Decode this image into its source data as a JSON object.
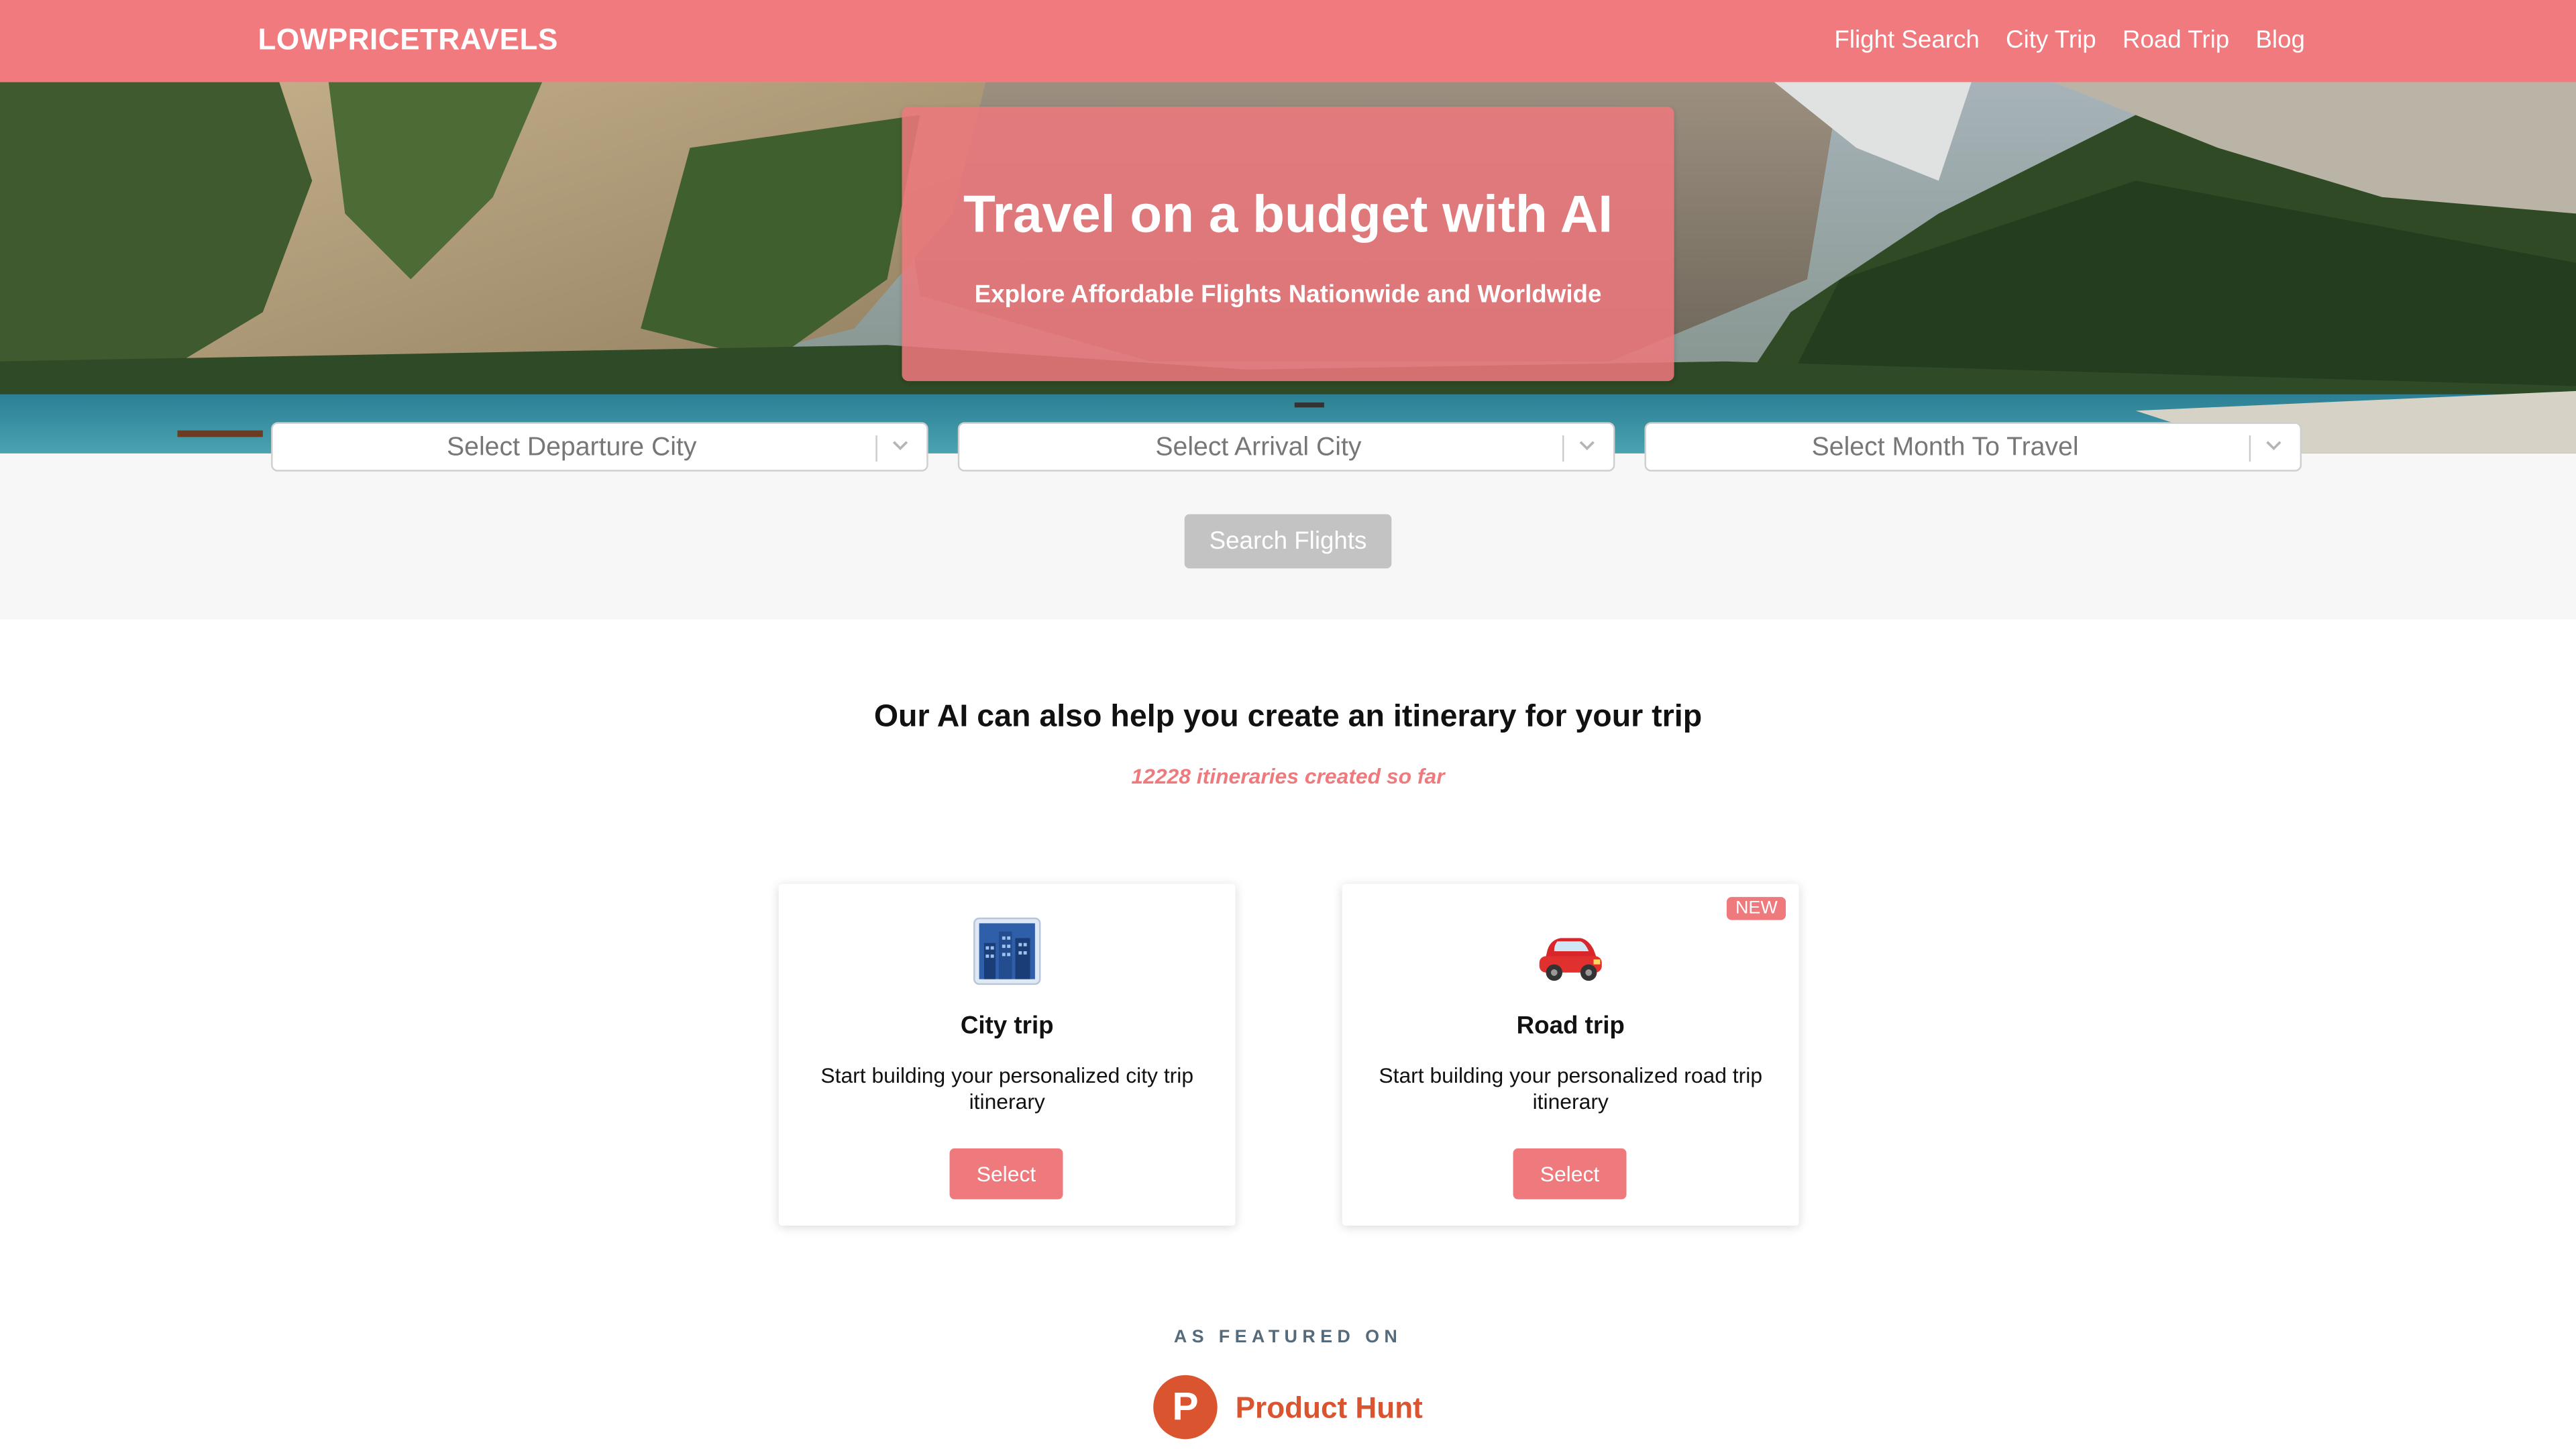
{
  "navbar": {
    "brand": "LOWPRICETRAVELS",
    "links": [
      "Flight Search",
      "City Trip",
      "Road Trip",
      "Blog"
    ]
  },
  "hero": {
    "title": "Travel on a budget with AI",
    "subtitle": "Explore Affordable Flights Nationwide and Worldwide"
  },
  "search": {
    "departure_placeholder": "Select Departure City",
    "arrival_placeholder": "Select Arrival City",
    "month_placeholder": "Select Month To Travel",
    "button_label": "Search Flights"
  },
  "itinerary": {
    "title": "Our AI can also help you create an itinerary for your trip",
    "counter": "12228 itineraries created so far",
    "cards": [
      {
        "icon": "cityscape-icon",
        "title": "City trip",
        "description": "Start building your personalized city trip itinerary",
        "button_label": "Select"
      },
      {
        "icon": "car-icon",
        "badge": "NEW",
        "title": "Road trip",
        "description": "Start building your personalized road trip itinerary",
        "button_label": "Select"
      }
    ]
  },
  "featured": {
    "label": "AS FEATURED ON",
    "logo_letter": "P",
    "logo_text": "Product Hunt"
  },
  "colors": {
    "accent": "#f07a7e",
    "search_button_disabled": "#c3c3c3",
    "product_hunt": "#da552f"
  }
}
